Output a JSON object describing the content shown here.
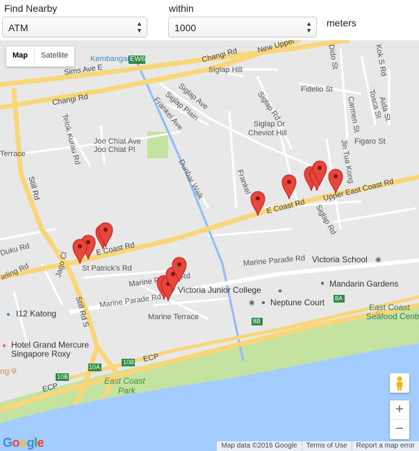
{
  "controls": {
    "find_label": "Find Nearby",
    "place_type": "ATM",
    "within_label": "within",
    "radius": "1000",
    "units_label": "meters"
  },
  "map_type": {
    "map": "Map",
    "satellite": "Satellite"
  },
  "zoom": {
    "in": "+",
    "out": "−"
  },
  "footer": {
    "map_data": "Map data ©2016 Google",
    "terms": "Terms of Use",
    "report": "Report a map error"
  },
  "logo": {
    "letters": [
      "G",
      "o",
      "o",
      "g",
      "l",
      "e"
    ],
    "colors": [
      "#4285F4",
      "#EA4335",
      "#FBBC05",
      "#4285F4",
      "#34A853",
      "#EA4335"
    ]
  },
  "road_labels": {
    "changi_rd_a": "Changi Rd",
    "changi_rd_b": "Changi Rd",
    "new_upper": "New Upper",
    "sims_ave_e": "Sims Ave E",
    "siglap_hill": "Siglap Hill",
    "fidelio_st": "Fidelio St",
    "dido_st": "Dido St",
    "koks_rd": "Kok S Rd",
    "tosca_st": "Tosca St",
    "aida_st": "Aida St",
    "carmen_st": "Carmen St",
    "figaro_st": "Figaro St",
    "siglap_ave": "Siglap Ave",
    "siglap_plain": "Siglap Plain",
    "frankel_ave": "Frankel Ave",
    "siglap_rd": "Siglap Rd",
    "siglap_dr": "Siglap Dr",
    "cheviot_hill": "Cheviot Hill",
    "jln_tua_kong": "Jln Tua Kong",
    "joo_chiat_ave": "Joo Chiat Ave",
    "joo_chiat_pl": "Joo Chiat Pl",
    "telok_kurau_rd": "Telok Kurau Rd",
    "terrace": "Terrace",
    "dunbar_walk": "Dunbar Walk",
    "frankel": "Frankel",
    "still_rd": "Still Rd",
    "upper_east_coast_rd": "Upper East Coast Rd",
    "e_coast_rd_a": "E Coast Rd",
    "e_coast_rd_b": "E Coast Rd",
    "siglap_rd2": "Siglap Rd",
    "duku_rd": "Duku Rd",
    "ieling_rd": "ieling Rd",
    "st_patricks_rd": "St Patrick's Rd",
    "jago_cl": "Jago Cl",
    "still_rd_s": "Still Rd S",
    "marine_parade_rd_a": "Marine Parade Rd",
    "marine_parade_rd_b": "Marine Parade Rd",
    "marine_parade_rd_c": "Marine Parade Rd",
    "marine_terrace": "Marine Terrace",
    "ecp_a": "ECP",
    "ecp_b": "ECP",
    "kembangan": "Kembangan",
    "ew6": "EW6",
    "exit_10a": "10A",
    "exit_10b_a": "10B",
    "exit_10b_b": "10B",
    "exit_8a": "8A",
    "exit_8b": "8B"
  },
  "places": {
    "victoria_school": "Victoria School",
    "victoria_jc": "Victoria Junior College",
    "neptune_court": "Neptune Court",
    "mandarin_gardens": "Mandarin Gardens",
    "east_coast_seafood_1": "East Coast",
    "east_coast_seafood_2": "Seafood Centre",
    "i12_katong": "I12 Katong",
    "hotel_grand_1": "Hotel Grand Mercure",
    "hotel_grand_2": "Singapore Roxy",
    "east_coast_park_1": "East Coast",
    "east_coast_park_2": "Park",
    "ng": "ng"
  },
  "markers": [
    {
      "id": "atm-1"
    },
    {
      "id": "atm-2"
    },
    {
      "id": "atm-3"
    },
    {
      "id": "atm-4"
    },
    {
      "id": "atm-5"
    },
    {
      "id": "atm-6"
    },
    {
      "id": "atm-7"
    },
    {
      "id": "atm-8"
    },
    {
      "id": "atm-9"
    },
    {
      "id": "atm-10"
    },
    {
      "id": "atm-11"
    },
    {
      "id": "atm-12"
    },
    {
      "id": "atm-13"
    },
    {
      "id": "atm-14"
    },
    {
      "id": "atm-15"
    }
  ],
  "colors": {
    "marker": "#E8453C",
    "sea": "#A3CCFF",
    "park": "#C5E3A0",
    "road_major": "#F9D67A",
    "road_minor": "#FFFFFF",
    "canal": "#8FBCF5"
  }
}
